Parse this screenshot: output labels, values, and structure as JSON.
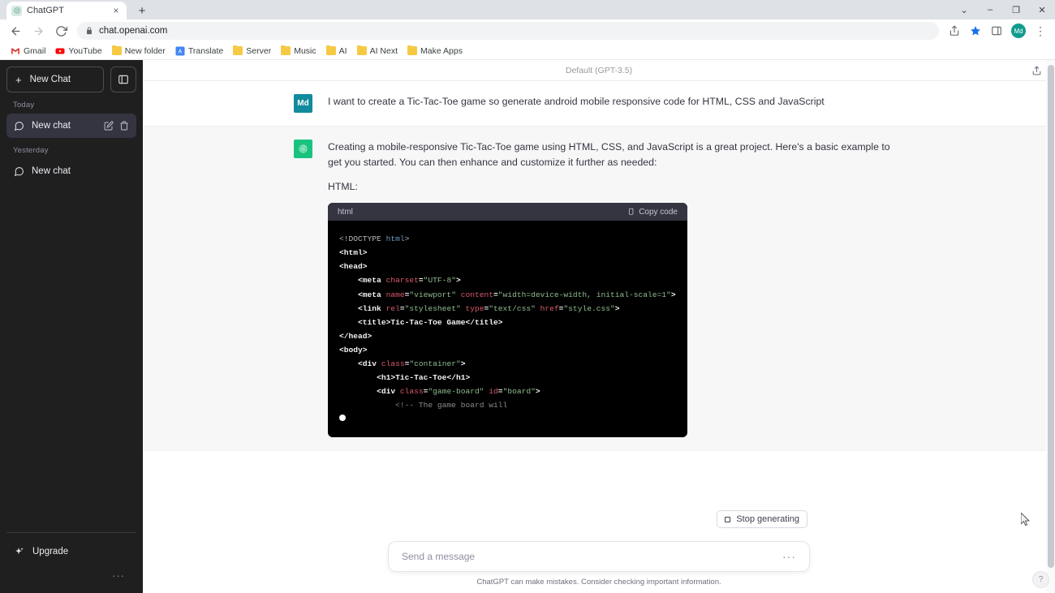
{
  "browser": {
    "tab": {
      "title": "ChatGPT",
      "favicon": "chatgpt-favicon",
      "close": "×"
    },
    "new_tab_label": "+",
    "window_controls": {
      "minimize_group": "⌄",
      "minimize": "–",
      "maximize": "❐",
      "close": "✕"
    },
    "nav": {
      "back": "back-arrow",
      "forward": "forward-arrow",
      "reload": "reload"
    },
    "omnibox": {
      "url": "chat.openai.com",
      "lock": "lock-icon"
    },
    "toolbar_icons": [
      "share-icon",
      "bookmark-star-icon",
      "side-panel-icon"
    ],
    "profile_initials": "Md",
    "menu": "⋮",
    "bookmarks": [
      {
        "label": "Gmail",
        "icon": "gmail-icon"
      },
      {
        "label": "YouTube",
        "icon": "youtube-icon"
      },
      {
        "label": "New folder",
        "icon": "folder-icon"
      },
      {
        "label": "Translate",
        "icon": "translate-icon"
      },
      {
        "label": "Server",
        "icon": "folder-icon"
      },
      {
        "label": "Music",
        "icon": "folder-icon"
      },
      {
        "label": "AI",
        "icon": "folder-icon"
      },
      {
        "label": "AI Next",
        "icon": "folder-icon"
      },
      {
        "label": "Make Apps",
        "icon": "folder-icon"
      }
    ]
  },
  "sidebar": {
    "new_chat_label": "New Chat",
    "new_chat_plus": "+",
    "collapse_icon": "sidebar-toggle-icon",
    "sections": [
      {
        "title": "Today",
        "items": [
          {
            "label": "New chat",
            "active": true,
            "actions": [
              "edit-icon",
              "trash-icon"
            ]
          }
        ]
      },
      {
        "title": "Yesterday",
        "items": [
          {
            "label": "New chat",
            "active": false,
            "actions": []
          }
        ]
      }
    ],
    "upgrade_label": "Upgrade",
    "more_dots": "···"
  },
  "main": {
    "model_label": "Default (GPT-3.5)",
    "share_icon": "share-upload-icon",
    "messages": [
      {
        "role": "user",
        "avatar_initials": "Md",
        "paragraphs": [
          "I want to create a Tic-Tac-Toe game so generate android mobile responsive code for HTML, CSS and JavaScript"
        ]
      },
      {
        "role": "assistant",
        "avatar_icon": "openai-logo-icon",
        "paragraphs": [
          "Creating a mobile-responsive Tic-Tac-Toe game using HTML, CSS, and JavaScript is a great project. Here's a basic example to get you started. You can then enhance and customize it further as needed:",
          "HTML:"
        ],
        "code_block": {
          "language": "html",
          "copy_label": "Copy code",
          "copy_icon": "clipboard-icon",
          "streaming": true,
          "lines": [
            "<!DOCTYPE html>",
            "<html>",
            "<head>",
            "    <meta charset=\"UTF-8\">",
            "    <meta name=\"viewport\" content=\"width=device-width, initial-scale=1\">",
            "    <link rel=\"stylesheet\" type=\"text/css\" href=\"style.css\">",
            "    <title>Tic-Tac-Toe Game</title>",
            "</head>",
            "<body>",
            "    <div class=\"container\">",
            "        <h1>Tic-Tac-Toe</h1>",
            "        <div class=\"game-board\" id=\"board\">",
            "            <!-- The game board will"
          ]
        }
      }
    ]
  },
  "composer": {
    "stop_generating_label": "Stop generating",
    "stop_icon": "stop-square-icon",
    "placeholder": "Send a message",
    "value": "",
    "more_icon": "···",
    "footnote": "ChatGPT can make mistakes. Consider checking important information."
  },
  "help": {
    "label": "?"
  },
  "colors": {
    "sidebar_bg": "#1f1f20",
    "active_chat": "#343541",
    "user_avatar": "#118a9c",
    "bot_avatar": "#19c37d",
    "code_header": "#343541",
    "code_body": "#000000",
    "bot_msg_bg": "#f7f7f8"
  }
}
